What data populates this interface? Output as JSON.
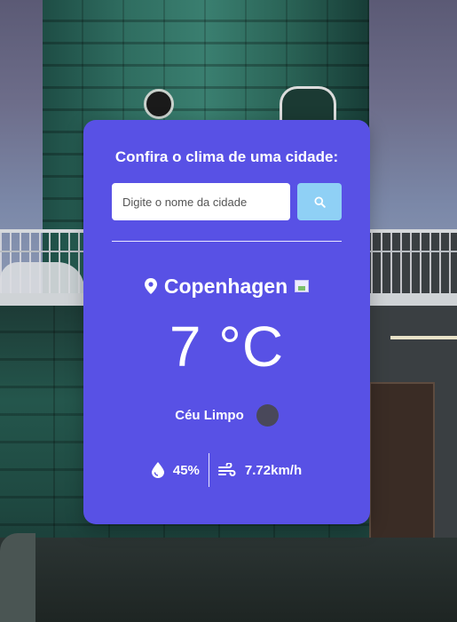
{
  "card": {
    "title": "Confira o clima de uma cidade:",
    "search": {
      "placeholder": "Digite o nome da cidade",
      "value": ""
    },
    "city": "Copenhagen",
    "temperature": "7",
    "unit": "°C",
    "description": "Céu Limpo",
    "humidity": "45%",
    "wind": "7.72km/h"
  },
  "icons": {
    "search": "search-icon",
    "location": "map-pin-icon",
    "flag": "country-flag-icon",
    "weather": "weather-icon",
    "humidity": "droplet-icon",
    "wind": "wind-icon"
  },
  "colors": {
    "card_background": "#5851e5",
    "search_button": "#8fd0f5",
    "text": "#ffffff"
  }
}
